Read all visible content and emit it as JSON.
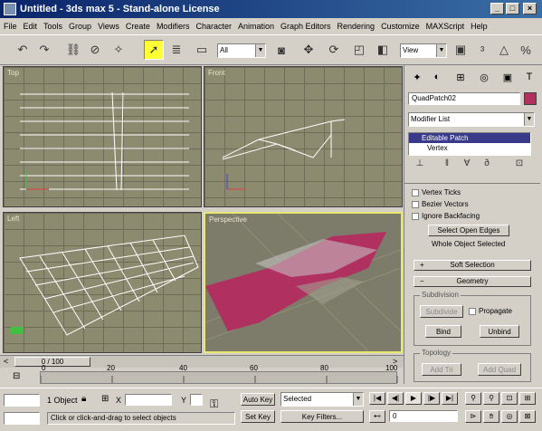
{
  "window": {
    "title": "Untitled - 3ds max 5 - Stand-alone License"
  },
  "menu": [
    "File",
    "Edit",
    "Tools",
    "Group",
    "Views",
    "Create",
    "Modifiers",
    "Character",
    "Animation",
    "Graph Editors",
    "Rendering",
    "Customize",
    "MAXScript",
    "Help"
  ],
  "toolbar": {
    "selection_filter": "All",
    "ref_coord": "View"
  },
  "viewports": {
    "top": "Top",
    "front": "Front",
    "left": "Left",
    "perspective": "Perspective"
  },
  "command_panel": {
    "object_name": "QuadPatch02",
    "modifier_list": "Modifier List",
    "stack_items": [
      "Editable Patch",
      "Vertex"
    ],
    "checks": [
      "Vertex Ticks",
      "Bezier Vectors",
      "Ignore Backfacing"
    ],
    "select_open_edges": "Select Open Edges",
    "selection_status": "Whole Object Selected",
    "soft_selection": "Soft Selection",
    "geometry": "Geometry",
    "subdivision_group": "Subdivision",
    "subdivide_button": "Subdivide",
    "propagate": "Propagate",
    "bind_button": "Bind",
    "unbind_button": "Unbind",
    "topology_group": "Topology",
    "add_tri": "Add Tri",
    "add_quad": "Add Quad"
  },
  "time": {
    "slider_label": "0 / 100",
    "ticks": [
      "0",
      "20",
      "40",
      "60",
      "80",
      "100"
    ]
  },
  "status": {
    "object_count": "1 Object",
    "x_label": "X",
    "y_label": "Y",
    "auto_key": "Auto Key",
    "set_key": "Set Key",
    "selected_dropdown": "Selected",
    "key_filters": "Key Filters...",
    "frame": "0",
    "prompt": "Click or click-and-drag to select objects"
  }
}
